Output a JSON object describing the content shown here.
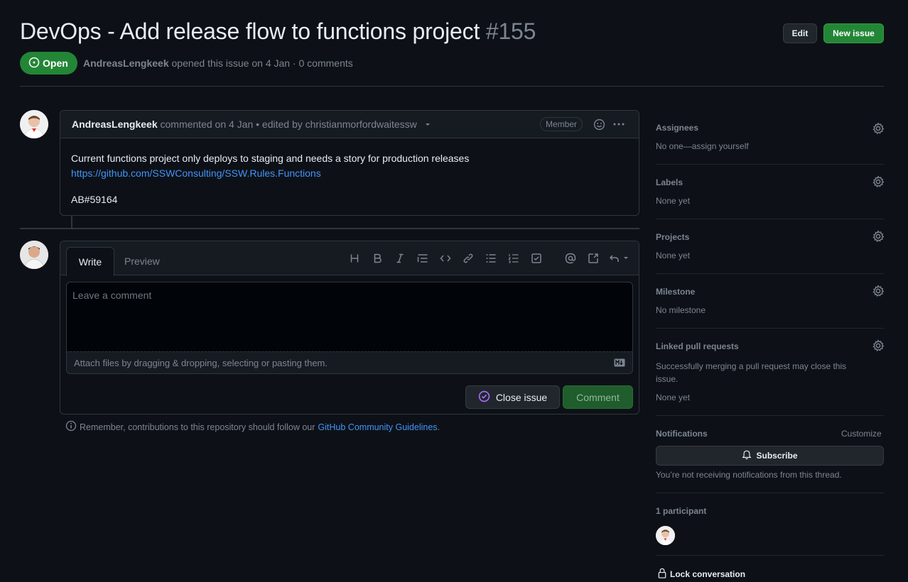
{
  "issue": {
    "title": "DevOps - Add release flow to functions project",
    "number": "#155",
    "state": "Open",
    "author": "AndreasLengkeek",
    "opened_text": "opened this issue on 4 Jan · 0 comments"
  },
  "header_buttons": {
    "edit": "Edit",
    "new_issue": "New issue"
  },
  "comment": {
    "author": "AndreasLengkeek",
    "meta": "commented on 4 Jan • edited by christianmorfordwaitessw",
    "badge": "Member",
    "body_line1": "Current functions project only deploys to staging and needs a story for production releases",
    "link": "https://github.com/SSWConsulting/SSW.Rules.Functions",
    "body_line2": "AB#59164"
  },
  "editor": {
    "tab_write": "Write",
    "tab_preview": "Preview",
    "placeholder": "Leave a comment",
    "attach_text": "Attach files by dragging & dropping, selecting or pasting them.",
    "close_issue": "Close issue",
    "comment": "Comment",
    "toolbar_icons": [
      "heading-icon",
      "bold-icon",
      "italic-icon",
      "quote-icon",
      "code-icon",
      "link-icon",
      "unordered-list-icon",
      "ordered-list-icon",
      "task-list-icon",
      "mention-icon",
      "reference-icon",
      "reply-icon"
    ]
  },
  "guidelines": {
    "prefix": "Remember, contributions to this repository should follow our",
    "link": "GitHub Community Guidelines",
    "suffix": "."
  },
  "sidebar": {
    "assignees": {
      "label": "Assignees",
      "value": "No one—assign yourself"
    },
    "labels": {
      "label": "Labels",
      "value": "None yet"
    },
    "projects": {
      "label": "Projects",
      "value": "None yet"
    },
    "milestone": {
      "label": "Milestone",
      "value": "No milestone"
    },
    "linked_prs": {
      "label": "Linked pull requests",
      "desc": "Successfully merging a pull request may close this issue.",
      "value": "None yet"
    },
    "notifications": {
      "label": "Notifications",
      "customize": "Customize",
      "subscribe": "Subscribe",
      "status": "You’re not receiving notifications from this thread."
    },
    "participants": {
      "label": "1 participant"
    },
    "lock": "Lock conversation"
  },
  "colors": {
    "accent_green": "#238636",
    "link_blue": "#4493f8",
    "background": "#0d1117"
  }
}
